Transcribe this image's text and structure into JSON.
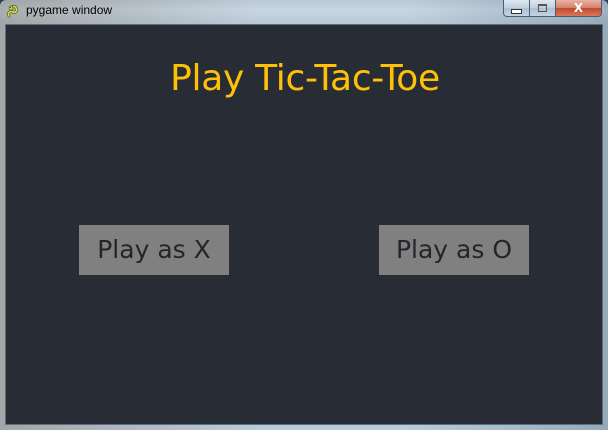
{
  "window": {
    "title": "pygame window",
    "icon": "pygame-snake-icon",
    "buttons": {
      "minimize_icon": "minimize-icon",
      "maximize_icon": "maximize-icon",
      "close_label": "X"
    }
  },
  "game": {
    "title": "Play Tic-Tac-Toe",
    "buttons": [
      {
        "label": "Play as X"
      },
      {
        "label": "Play as O"
      }
    ]
  },
  "colors": {
    "background": "#282c35",
    "title": "#ffc107",
    "button_bg": "#808080",
    "button_text": "#232529"
  }
}
